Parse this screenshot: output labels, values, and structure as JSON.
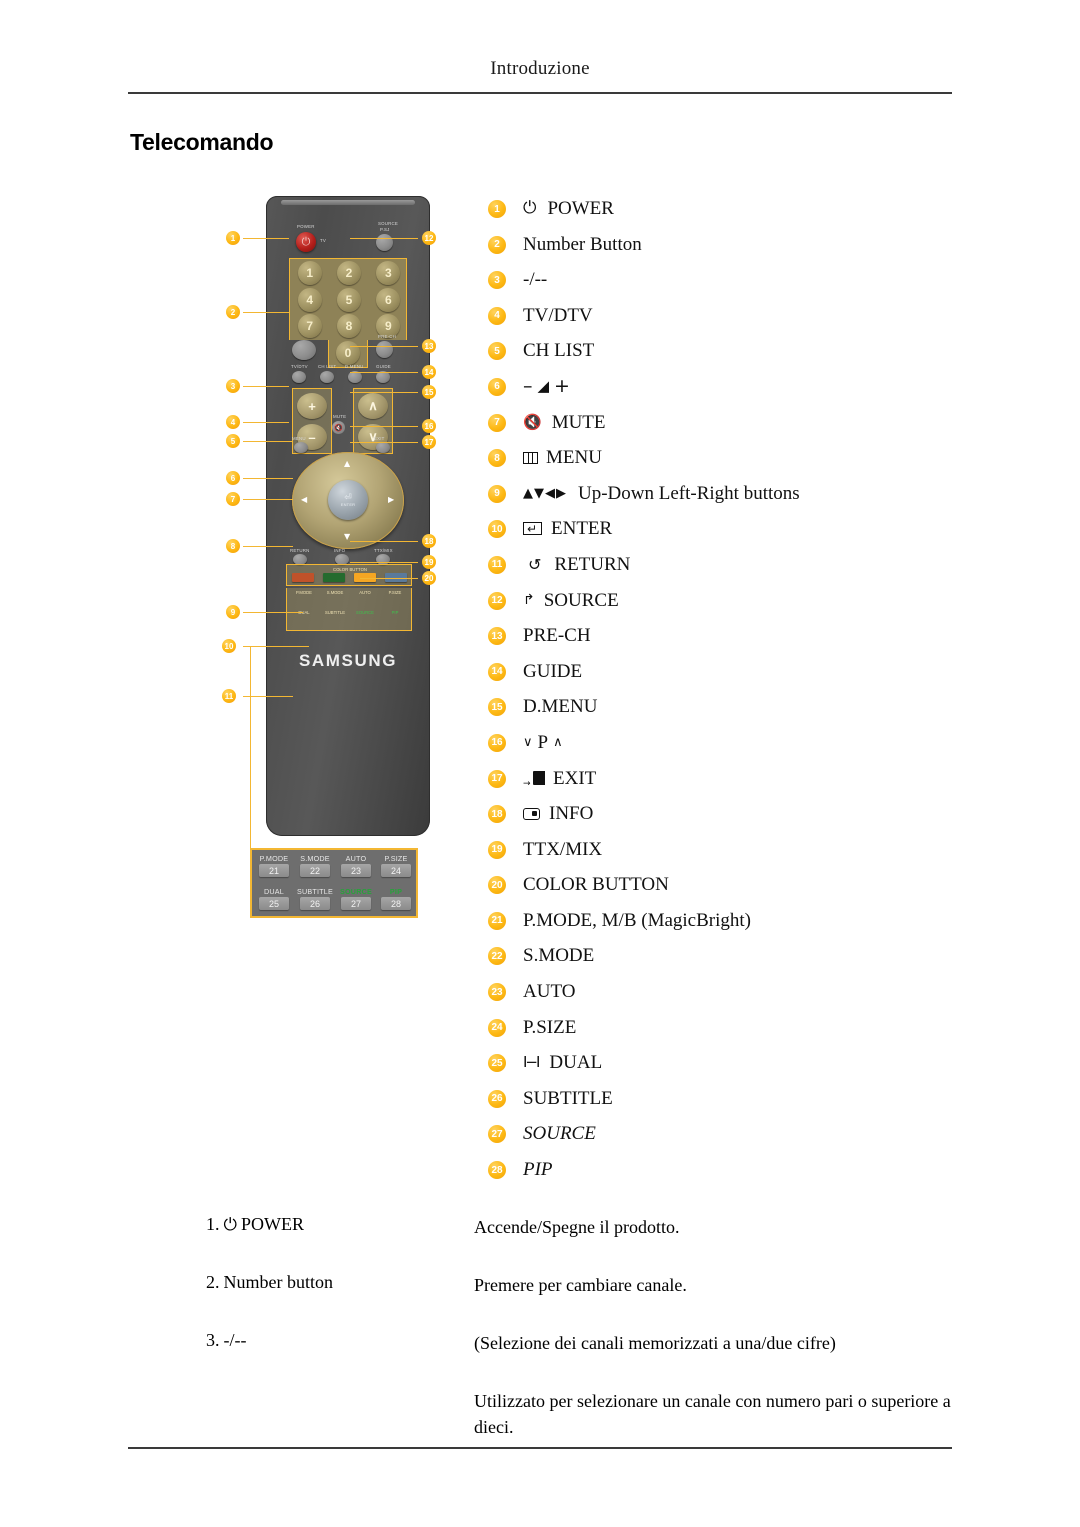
{
  "header": {
    "running_head": "Introduzione"
  },
  "section": {
    "title": "Telecomando"
  },
  "legend": {
    "items": [
      {
        "n": "1",
        "icon": "power-icon",
        "label": "POWER"
      },
      {
        "n": "2",
        "icon": "",
        "label": "Number Button"
      },
      {
        "n": "3",
        "icon": "",
        "label": "-/--"
      },
      {
        "n": "4",
        "icon": "",
        "label": "TV/DTV"
      },
      {
        "n": "5",
        "icon": "",
        "label": "CH LIST"
      },
      {
        "n": "6",
        "icon": "volume-icon",
        "label": ""
      },
      {
        "n": "7",
        "icon": "mute-icon",
        "label": "MUTE"
      },
      {
        "n": "8",
        "icon": "menu-icon",
        "label": "MENU"
      },
      {
        "n": "9",
        "icon": "direction-arrows-icon",
        "label": "Up-Down Left-Right buttons"
      },
      {
        "n": "10",
        "icon": "enter-icon",
        "label": "ENTER"
      },
      {
        "n": "11",
        "icon": "return-icon",
        "label": "RETURN"
      },
      {
        "n": "12",
        "icon": "source-icon",
        "label": "SOURCE"
      },
      {
        "n": "13",
        "icon": "",
        "label": "PRE-CH"
      },
      {
        "n": "14",
        "icon": "",
        "label": "GUIDE"
      },
      {
        "n": "15",
        "icon": "",
        "label": "D.MENU"
      },
      {
        "n": "16",
        "icon": "channel-updown-icon",
        "label": ""
      },
      {
        "n": "17",
        "icon": "exit-icon",
        "label": "EXIT"
      },
      {
        "n": "18",
        "icon": "info-icon",
        "label": "INFO"
      },
      {
        "n": "19",
        "icon": "",
        "label": "TTX/MIX"
      },
      {
        "n": "20",
        "icon": "",
        "label": "COLOR BUTTON"
      },
      {
        "n": "21",
        "icon": "",
        "label": "P.MODE, M/B (MagicBright)"
      },
      {
        "n": "22",
        "icon": "",
        "label": "S.MODE"
      },
      {
        "n": "23",
        "icon": "",
        "label": "AUTO"
      },
      {
        "n": "24",
        "icon": "",
        "label": "P.SIZE"
      },
      {
        "n": "25",
        "icon": "dual-icon",
        "label": "DUAL"
      },
      {
        "n": "26",
        "icon": "",
        "label": "SUBTITLE"
      },
      {
        "n": "27",
        "icon": "",
        "label": "SOURCE",
        "italic": true
      },
      {
        "n": "28",
        "icon": "",
        "label": "PIP",
        "italic": true
      }
    ],
    "glyphs": {
      "power": "⏻",
      "volume_minus": "–",
      "volume_wedge": "◢",
      "volume_plus": "+",
      "mute": "🔇",
      "arrows": "▲▼◀▶",
      "return": "↺",
      "source": "↱",
      "channel_down": "∨",
      "channel_p": "P",
      "channel_up": "∧",
      "exit_arrow": "→",
      "dual": "I−I"
    }
  },
  "remote": {
    "brand": "SAMSUNG",
    "printed_labels": {
      "power": "POWER",
      "source": "SOURCE",
      "source_sub": "P.SJ",
      "tvdtv": "TV/DTV",
      "chlist": "CH LIST",
      "dmenu": "D.MENU",
      "guide": "GUIDE",
      "prech": "PRE-CH",
      "mute": "MUTE",
      "menu": "MENU",
      "exit": "EXIT",
      "return": "RETURN",
      "info": "INFO",
      "ttxmix": "TTX/MIX",
      "enter": "ENTER",
      "color_button": "COLOR BUTTON"
    },
    "keypad": {
      "rows": [
        [
          "1",
          "2",
          "3"
        ],
        [
          "4",
          "5",
          "6"
        ],
        [
          "7",
          "8",
          "9"
        ]
      ],
      "zero": "0"
    },
    "volume": {
      "plus": "+",
      "minus": "–"
    },
    "channel": {
      "up": "∧",
      "down": "∨"
    },
    "color_buttons": [
      "#c0522a",
      "#256b2e",
      "#f5a623",
      "#5a7a9b"
    ],
    "function_labels": [
      {
        "label": "P.MODE"
      },
      {
        "label": "S.MODE"
      },
      {
        "label": "AUTO"
      },
      {
        "label": "P.SIZE"
      },
      {
        "label": "DUAL"
      },
      {
        "label": "SUBTITLE"
      },
      {
        "label": "SOURCE",
        "green": true
      },
      {
        "label": "PIP",
        "green": true
      }
    ],
    "figure_badges": [
      "1",
      "2",
      "3",
      "4",
      "5",
      "6",
      "7",
      "8",
      "9",
      "10",
      "11",
      "12",
      "13",
      "14",
      "15",
      "16",
      "17",
      "18",
      "19",
      "20"
    ]
  },
  "zoom_callout": {
    "cells": [
      {
        "label": "P.MODE",
        "key": "21"
      },
      {
        "label": "S.MODE",
        "key": "22"
      },
      {
        "label": "AUTO",
        "key": "23"
      },
      {
        "label": "P.SIZE",
        "key": "24"
      },
      {
        "label": "DUAL",
        "key": "25"
      },
      {
        "label": "SUBTITLE",
        "key": "26"
      },
      {
        "label": "SOURCE",
        "key": "27",
        "green": true
      },
      {
        "label": "PIP",
        "key": "28",
        "green": true
      }
    ]
  },
  "descriptions": [
    {
      "num": "1.",
      "icon": "power-icon",
      "term": "POWER",
      "def": "Accende/Spegne il prodotto."
    },
    {
      "num": "2.",
      "icon": "",
      "term": "Number button",
      "def": "Premere per cambiare canale."
    },
    {
      "num": "3.",
      "icon": "",
      "term": "-/--",
      "def": "(Selezione dei canali memorizzati a una/due cifre)"
    },
    {
      "num": "",
      "icon": "",
      "term": "",
      "def": "Utilizzato per selezionare un canale con numero pari o superiore a dieci."
    }
  ],
  "colors": {
    "badge_orange": "#fdb813",
    "remote_body": "#4c4c4c",
    "keypad_gold": "#8e8257",
    "accent_outline": "#f3b733"
  }
}
